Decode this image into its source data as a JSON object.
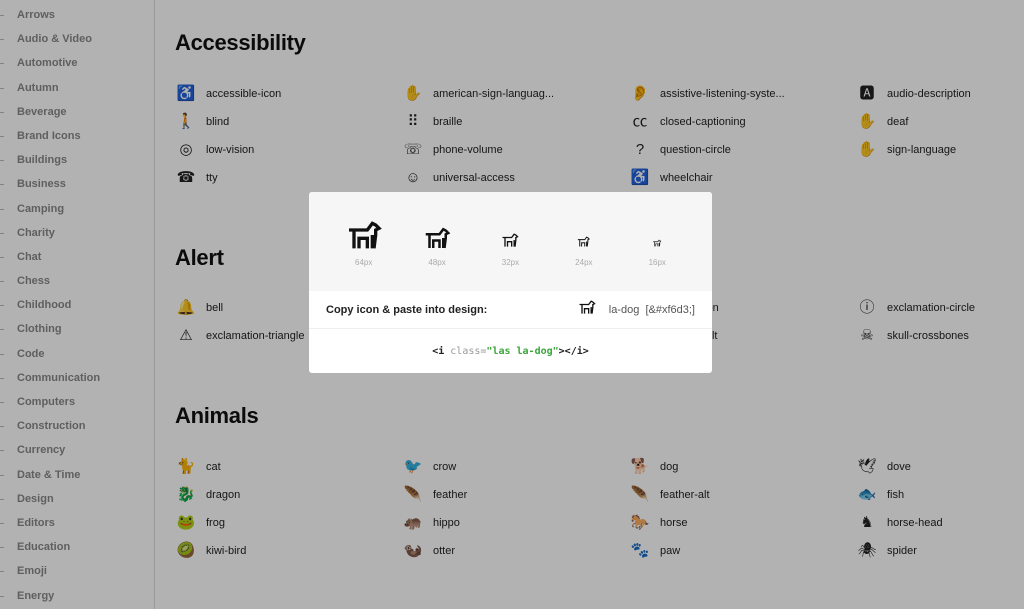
{
  "sidebar": {
    "items": [
      "Arrows",
      "Audio & Video",
      "Automotive",
      "Autumn",
      "Beverage",
      "Brand Icons",
      "Buildings",
      "Business",
      "Camping",
      "Charity",
      "Chat",
      "Chess",
      "Childhood",
      "Clothing",
      "Code",
      "Communication",
      "Computers",
      "Construction",
      "Currency",
      "Date & Time",
      "Design",
      "Editors",
      "Education",
      "Emoji",
      "Energy"
    ]
  },
  "sections": [
    {
      "title": "Accessibility",
      "items": [
        {
          "icon": "♿",
          "name": "accessible-icon"
        },
        {
          "icon": "✋",
          "name": "american-sign-languag..."
        },
        {
          "icon": "👂",
          "name": "assistive-listening-syste..."
        },
        {
          "icon": "🅰",
          "name": "audio-description"
        },
        {
          "icon": "🚶",
          "name": "blind"
        },
        {
          "icon": "⠿",
          "name": "braille"
        },
        {
          "icon": "㏄",
          "name": "closed-captioning"
        },
        {
          "icon": "✋",
          "name": "deaf"
        },
        {
          "icon": "◎",
          "name": "low-vision"
        },
        {
          "icon": "☏",
          "name": "phone-volume"
        },
        {
          "icon": "?",
          "name": "question-circle"
        },
        {
          "icon": "✋",
          "name": "sign-language"
        },
        {
          "icon": "☎",
          "name": "tty"
        },
        {
          "icon": "☺",
          "name": "universal-access"
        },
        {
          "icon": "♿",
          "name": "wheelchair"
        }
      ]
    },
    {
      "title": "Alert",
      "items": [
        {
          "icon": "🔔",
          "name": "bell"
        },
        {
          "icon": "",
          "name": ""
        },
        {
          "icon": "!",
          "name": "exclamation"
        },
        {
          "icon": "ⓘ",
          "name": "exclamation-circle"
        },
        {
          "icon": "⚠",
          "name": "exclamation-triangle"
        },
        {
          "icon": "",
          "name": ""
        },
        {
          "icon": "☢",
          "name": "radiation-alt"
        },
        {
          "icon": "☠",
          "name": "skull-crossbones"
        }
      ]
    },
    {
      "title": "Animals",
      "items": [
        {
          "icon": "🐈",
          "name": "cat"
        },
        {
          "icon": "🐦",
          "name": "crow"
        },
        {
          "icon": "🐕",
          "name": "dog"
        },
        {
          "icon": "🕊",
          "name": "dove"
        },
        {
          "icon": "🐉",
          "name": "dragon"
        },
        {
          "icon": "🪶",
          "name": "feather"
        },
        {
          "icon": "🪶",
          "name": "feather-alt"
        },
        {
          "icon": "🐟",
          "name": "fish"
        },
        {
          "icon": "🐸",
          "name": "frog"
        },
        {
          "icon": "🦛",
          "name": "hippo"
        },
        {
          "icon": "🐎",
          "name": "horse"
        },
        {
          "icon": "♞",
          "name": "horse-head"
        },
        {
          "icon": "🥝",
          "name": "kiwi-bird"
        },
        {
          "icon": "🦦",
          "name": "otter"
        },
        {
          "icon": "🐾",
          "name": "paw"
        },
        {
          "icon": "🕷",
          "name": "spider"
        }
      ]
    }
  ],
  "modal": {
    "icon": "dog-icon",
    "sizes": [
      "64px",
      "48px",
      "32px",
      "24px",
      "16px"
    ],
    "copy_label": "Copy icon & paste into design:",
    "icon_name": "la-dog",
    "icon_code": "[&#xf6d3;]",
    "code_open": "<i",
    "code_attr": "class=",
    "code_value": "\"las la-dog\"",
    "code_close": "></i>",
    "accent": "#3aa53a"
  }
}
